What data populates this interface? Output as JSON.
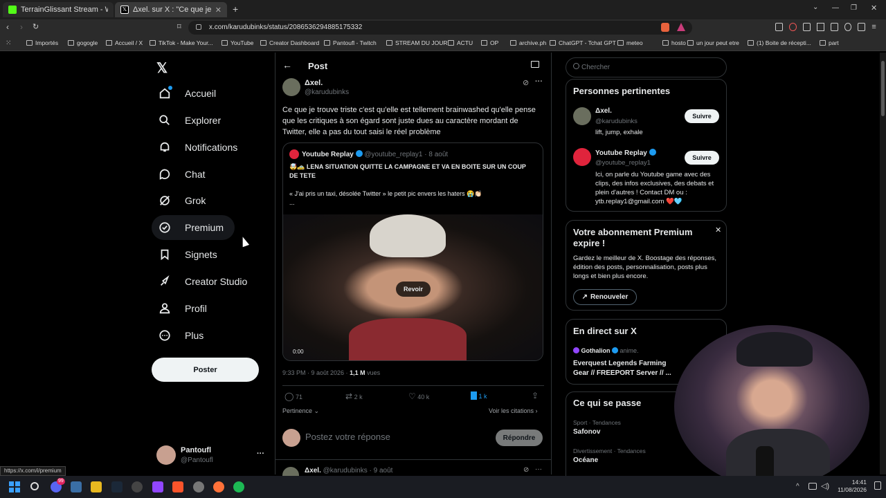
{
  "browser": {
    "tabs": [
      {
        "title": "TerrainGlissant Stream - Watch Live o",
        "color": "#53fc18",
        "active": false
      },
      {
        "title": "Δxel. sur X : \"Ce que je trouve tri",
        "color": "#000000",
        "active": true
      }
    ],
    "new_tab": "+",
    "url": "x.com/karudubinks/status/2086536294885175332",
    "bookmarks": [
      "Importés",
      "gogogle",
      "Accueil / X",
      "TikTok - Make Your...",
      "YouTube",
      "Creator Dashboard",
      "Pantoufl - Twitch",
      "STREAM DU JOUR",
      "ACTU",
      "OP",
      "archive.ph",
      "ChatGPT - Tchat GPT",
      "meteo",
      "hosto",
      "un jour peut etre",
      "(1) Boite de récepti...",
      "part"
    ],
    "status_url": "https://x.com/i/premium"
  },
  "nav": {
    "items": [
      {
        "label": "Accueil",
        "icon": "home-icon"
      },
      {
        "label": "Explorer",
        "icon": "search-icon"
      },
      {
        "label": "Notifications",
        "icon": "bell-icon"
      },
      {
        "label": "Chat",
        "icon": "chat-icon"
      },
      {
        "label": "Grok",
        "icon": "grok-icon"
      },
      {
        "label": "Premium",
        "icon": "premium-icon"
      },
      {
        "label": "Signets",
        "icon": "bookmark-icon"
      },
      {
        "label": "Creator Studio",
        "icon": "rocket-icon"
      },
      {
        "label": "Profil",
        "icon": "person-icon"
      },
      {
        "label": "Plus",
        "icon": "more-icon"
      }
    ],
    "post_button": "Poster",
    "account": {
      "name": "Pantoufl",
      "handle": "@Pantoufl"
    }
  },
  "post": {
    "header": "Post",
    "author": {
      "name": "Δxel.",
      "handle": "@karudubinks"
    },
    "text": "Ce que je trouve triste c'est qu'elle est tellement brainwashed qu'elle pense que les critiques à son égard sont juste dues au caractère mordant de Twitter, elle a pas du tout saisi le réel problème",
    "quote": {
      "name": "Youtube Replay",
      "handle": "@youtube_replay1",
      "date": "· 8 août",
      "line1": "🤯🚕 LENA SITUATION QUITTE LA CAMPAGNE ET VA EN BOITE SUR UN COUP DE TETE",
      "line2": "« J'ai pris un taxi, désolée Twitter » le petit pic envers les haters 😭👏🏻",
      "ellipsis": "...",
      "replay": "Revoir",
      "time": "0:00"
    },
    "meta": {
      "time": "9:33 PM · 9 août 2026 · ",
      "views": "1,1 M",
      "views_label": " vues"
    },
    "stats": {
      "replies": "71",
      "reposts": "2 k",
      "likes": "40 k",
      "bookmarks": "1 k"
    },
    "sort": "Pertinence",
    "citations": "Voir les citations",
    "reply_placeholder": "Postez votre réponse",
    "reply_button": "Répondre",
    "next": {
      "name": "Δxel.",
      "handle": "@karudubinks",
      "date": "· 9 août"
    }
  },
  "sidebar": {
    "search_placeholder": "Chercher",
    "relevant": {
      "title": "Personnes pertinentes",
      "people": [
        {
          "name": "Δxel.",
          "handle": "@karudubinks",
          "bio": "lift, jump, exhale",
          "follow": "Suivre"
        },
        {
          "name": "Youtube Replay",
          "handle": "@youtube_replay1",
          "bio": "Ici, on parle du Youtube game avec des clips, des infos exclusives, des debats et plein d'autres ! Contact DM ou : ytb.replay1@gmail.com ❤️🩵",
          "follow": "Suivre"
        }
      ]
    },
    "premium": {
      "title": "Votre abonnement Premium expire !",
      "text": "Gardez le meilleur de X. Boostage des réponses, édition des posts, personnalisation, posts plus longs et bien plus encore.",
      "button": "Renouveler"
    },
    "live": {
      "title": "En direct sur X",
      "user": "Gothalion",
      "suffix": "anime.",
      "text": "Everquest Legends Farming Gear // FREEPORT Server // ..."
    },
    "trends": {
      "title": "Ce qui se passe",
      "items": [
        {
          "cat": "Sport · Tendances",
          "name": "Safonov"
        },
        {
          "cat": "Divertissement · Tendances",
          "name": "Océane"
        }
      ]
    }
  },
  "taskbar": {
    "time": "14:41",
    "date": "11/08/2026",
    "badge": "99"
  },
  "colors": {
    "accent": "#1d9bf0",
    "bg": "#000000",
    "border": "#2f3336",
    "muted": "#71767b"
  }
}
